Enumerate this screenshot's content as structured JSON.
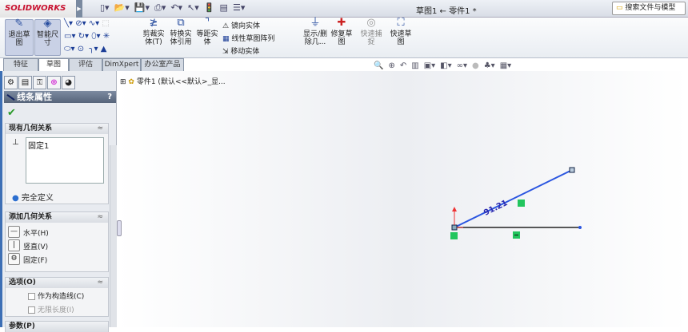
{
  "app": {
    "logo": "SOLIDWORKS",
    "title": "草图1 ← 零件1 *",
    "search_placeholder": "搜索文件与模型"
  },
  "quick_access": [
    "new-icon",
    "open-icon",
    "save-icon",
    "print-icon",
    "undo-icon",
    "select-icon",
    "rebuild-icon",
    "options-icon",
    "customize-icon"
  ],
  "ribbon": {
    "exit_sketch": "退出草图",
    "smart_dim": "智能尺寸",
    "trim": "剪裁实体(T)",
    "convert": "转换实体引用",
    "offset": "等距实体",
    "mirror": "镜向实体",
    "linear_pattern": "线性草图阵列",
    "move": "移动实体",
    "display_delete": "显示/删除几...",
    "repair": "修复草图",
    "quick_snap": "快速捕捉",
    "rapid_sketch": "快速草图"
  },
  "tabs": [
    "特征",
    "草图",
    "评估",
    "DimXpert",
    "办公室产品"
  ],
  "active_tab": 1,
  "tree": {
    "root": "零件1 (默认<<默认>_显..."
  },
  "panel": {
    "title": "线条属性",
    "help": "?",
    "existing": {
      "title": "现有几何关系",
      "items": [
        "固定1"
      ],
      "status": "完全定义"
    },
    "add": {
      "title": "添加几何关系",
      "items": [
        "水平(H)",
        "竖直(V)",
        "固定(F)"
      ]
    },
    "options": {
      "title": "选项(O)",
      "items": [
        "作为构造线(C)",
        "无限长度(I)"
      ]
    },
    "params": {
      "title": "参数(P)"
    }
  },
  "sketch": {
    "dimension": "91.21",
    "colors": {
      "line": "#2a55e0",
      "base": "#222222",
      "relation": "#22c55e"
    }
  }
}
